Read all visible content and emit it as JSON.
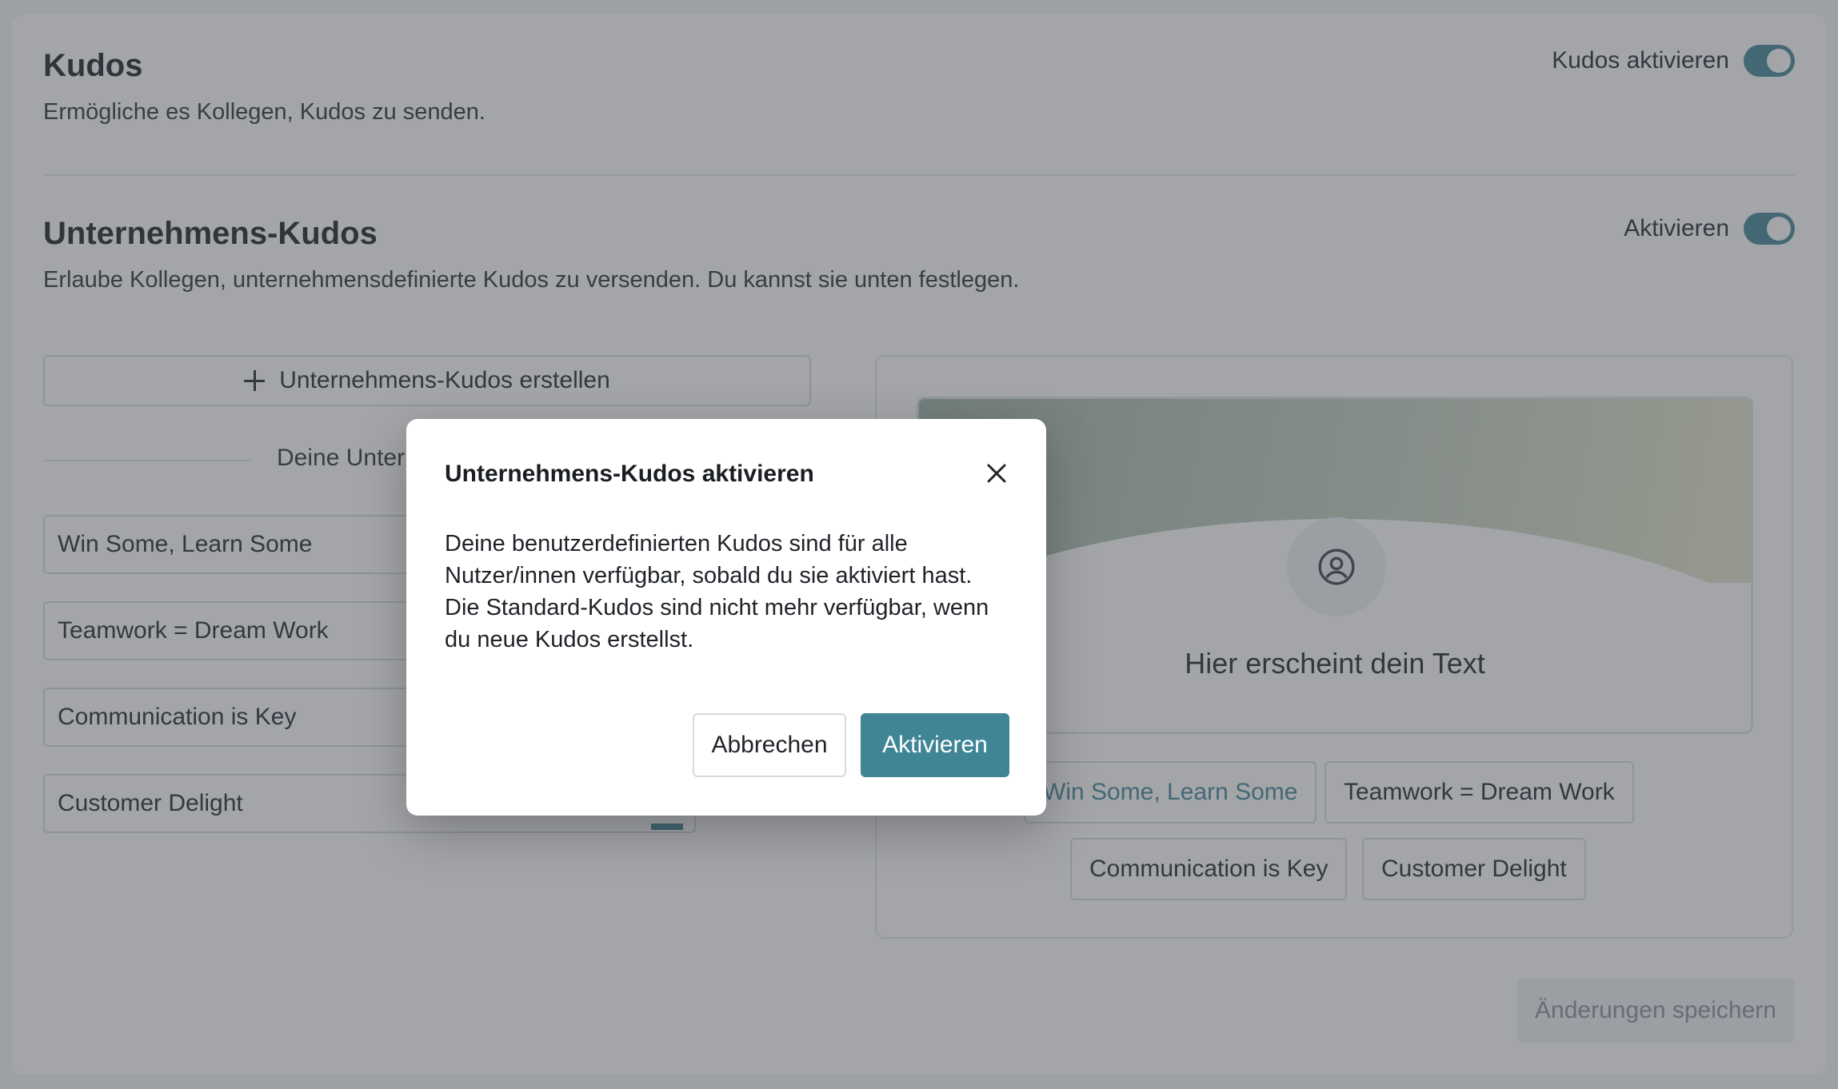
{
  "kudos_section": {
    "title": "Kudos",
    "description": "Ermögliche es Kollegen, Kudos zu senden.",
    "toggle_label": "Kudos aktivieren",
    "toggle_on": true
  },
  "company_section": {
    "title": "Unternehmens-Kudos",
    "description": "Erlaube Kollegen, unternehmensdefinierte Kudos zu versenden. Du kannst sie unten festlegen.",
    "toggle_label": "Aktivieren",
    "toggle_on": true,
    "create_button": "Unternehmens-Kudos erstellen",
    "list_heading": "Deine Unter",
    "items": [
      {
        "label": "Win Some, Learn Some"
      },
      {
        "label": "Teamwork = Dream Work"
      },
      {
        "label": "Communication is Key"
      },
      {
        "label": "Customer Delight"
      }
    ]
  },
  "preview": {
    "placeholder_text": "Hier erscheint dein Text",
    "chips": [
      {
        "label": "Win Some, Learn Some",
        "selected": true
      },
      {
        "label": "Teamwork = Dream Work",
        "selected": false
      },
      {
        "label": "Communication is Key",
        "selected": false
      },
      {
        "label": "Customer Delight",
        "selected": false
      }
    ]
  },
  "footer": {
    "save_label": "Änderungen speichern"
  },
  "modal": {
    "title": "Unternehmens-Kudos aktivieren",
    "body_lines": [
      "Deine benutzerdefinierten Kudos sind für alle",
      "Nutzer/innen verfügbar, sobald du sie aktiviert hast.",
      "Die Standard-Kudos sind nicht mehr verfügbar, wenn",
      "du neue Kudos erstellst."
    ],
    "cancel_label": "Abbrechen",
    "confirm_label": "Aktivieren"
  },
  "colors": {
    "accent": "#3f8595",
    "overlay": "#484c54"
  }
}
